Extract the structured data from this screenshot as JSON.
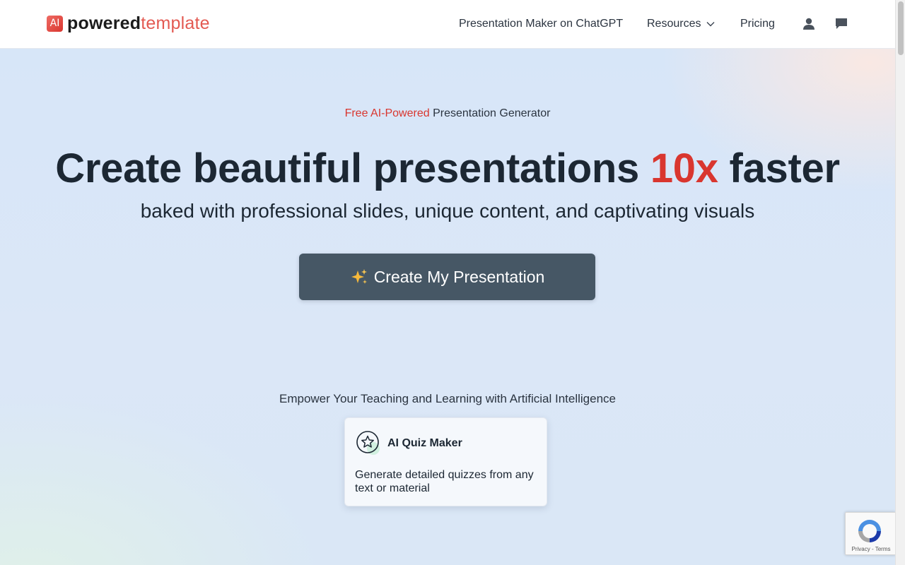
{
  "brand": {
    "logo_mark": "AI",
    "name_bold": "powered",
    "name_light": "template",
    "colors": {
      "accent": "#d9362f",
      "cta_bg": "#465765",
      "text": "#1c2733"
    }
  },
  "nav": {
    "chatgpt_label": "Presentation Maker on ChatGPT",
    "resources_label": "Resources",
    "pricing_label": "Pricing",
    "icons": [
      "user-icon",
      "chat-icon",
      "chevron-down-icon"
    ]
  },
  "hero": {
    "eyebrow_accent": "Free AI-Powered",
    "eyebrow_rest": "Presentation Generator",
    "headline_before": "Create beautiful presentations",
    "headline_accent": "10x",
    "headline_after": "faster",
    "subline": "baked with professional slides, unique content, and captivating visuals",
    "cta_label": "Create My Presentation",
    "cta_icon": "sparkles-icon"
  },
  "teaching": {
    "heading": "Empower Your Teaching and Learning with Artificial Intelligence",
    "card": {
      "title": "AI Quiz Maker",
      "description": "Generate detailed quizzes from any text or material",
      "icon": "star-badge-icon"
    }
  },
  "recaptcha": {
    "links": "Privacy - Terms"
  }
}
